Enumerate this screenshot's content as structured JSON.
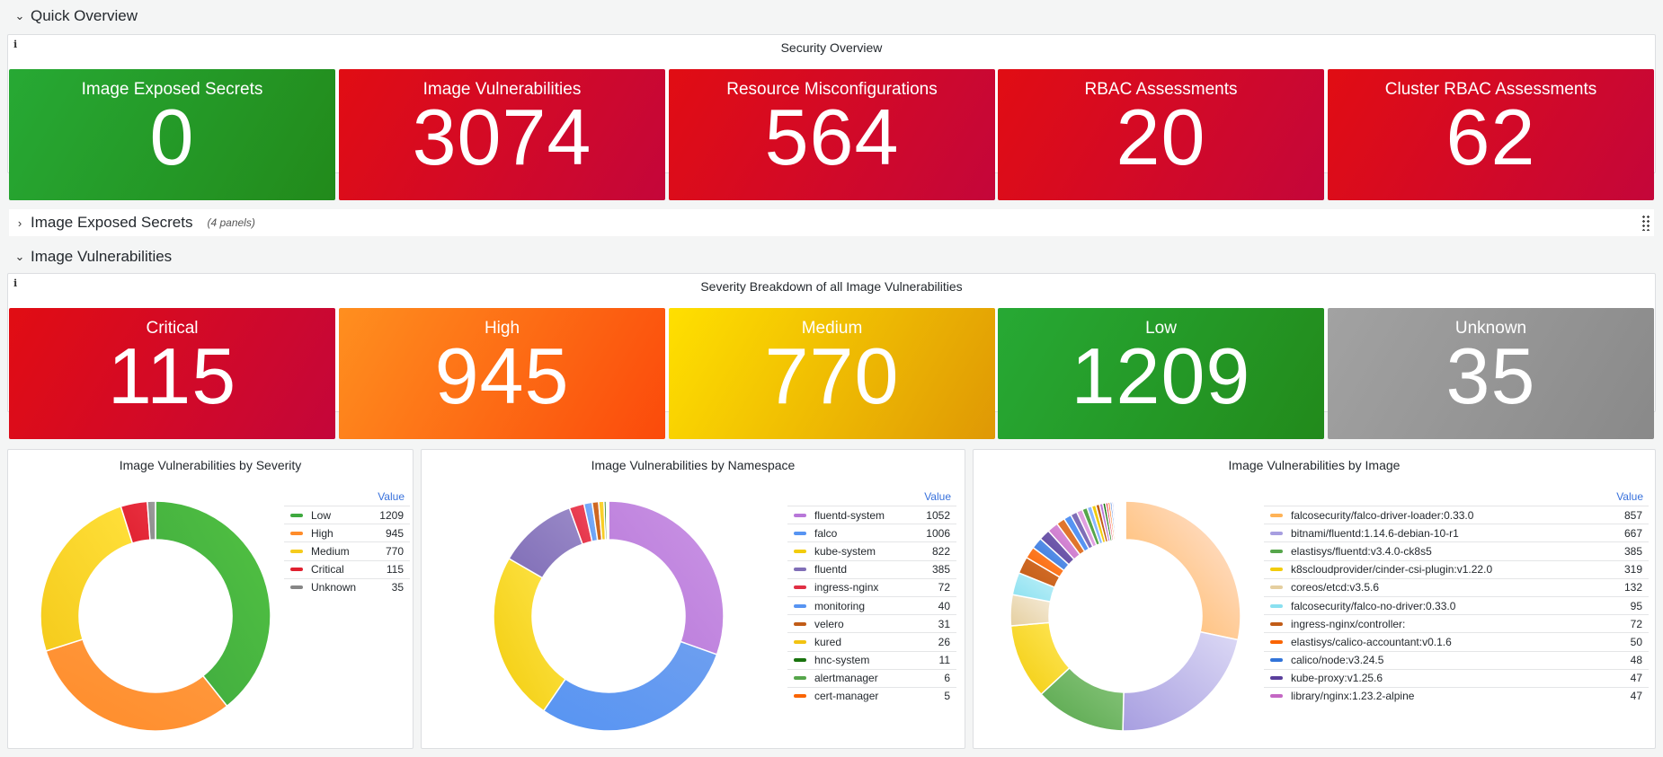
{
  "rows": {
    "quick_overview": {
      "chevron": "⌄",
      "title": "Quick Overview"
    },
    "exposed_secrets": {
      "chevron": "›",
      "title": "Image Exposed Secrets",
      "count": "(4 panels)"
    },
    "image_vulns": {
      "chevron": "⌄",
      "title": "Image Vulnerabilities"
    }
  },
  "security_overview": {
    "title": "Security Overview",
    "info_icon": "i",
    "stats": [
      {
        "label": "Image Exposed Secrets",
        "value": "0",
        "color_from": "#27a934",
        "color_to": "#228a1b"
      },
      {
        "label": "Image Vulnerabilities",
        "value": "3074",
        "color_from": "#e10d13",
        "color_to": "#c4063a"
      },
      {
        "label": "Resource Misconfigurations",
        "value": "564",
        "color_from": "#e10d13",
        "color_to": "#c4063a"
      },
      {
        "label": "RBAC Assessments",
        "value": "20",
        "color_from": "#e10d13",
        "color_to": "#c4063a"
      },
      {
        "label": "Cluster RBAC Assessments",
        "value": "62",
        "color_from": "#e10d13",
        "color_to": "#c4063a"
      }
    ]
  },
  "severity_breakdown": {
    "title": "Severity Breakdown of all Image Vulnerabilities",
    "info_icon": "i",
    "stats": [
      {
        "label": "Critical",
        "value": "115",
        "color_from": "#e10d13",
        "color_to": "#c4063a"
      },
      {
        "label": "High",
        "value": "945",
        "color_from": "#ff8f1f",
        "color_to": "#fb4a0b"
      },
      {
        "label": "Medium",
        "value": "770",
        "color_from": "#ffe000",
        "color_to": "#df9805"
      },
      {
        "label": "Low",
        "value": "1209",
        "color_from": "#27a934",
        "color_to": "#228a1b"
      },
      {
        "label": "Unknown",
        "value": "35",
        "color_from": "#a2a2a2",
        "color_to": "#898989"
      }
    ]
  },
  "legend_header": "Value",
  "chart_data": [
    {
      "type": "pie",
      "title": "Image Vulnerabilities by Severity",
      "categories": [
        "Low",
        "High",
        "Medium",
        "Critical",
        "Unknown"
      ],
      "values": [
        1209,
        945,
        770,
        115,
        35
      ],
      "colors": [
        "#3ea93f",
        "#ff8c2a",
        "#f5cb1c",
        "#e0202f",
        "#868686"
      ],
      "gradient_to": [
        "#52c242",
        "#ff9a40",
        "#ffe03a",
        "#e83040",
        "#a0a0a0"
      ],
      "legend": "right"
    },
    {
      "type": "pie",
      "title": "Image Vulnerabilities by Namespace",
      "categories": [
        "fluentd-system",
        "falco",
        "kube-system",
        "fluentd",
        "ingress-nginx",
        "monitoring",
        "velero",
        "kured",
        "hnc-system",
        "alertmanager",
        "cert-manager"
      ],
      "values": [
        1052,
        1006,
        822,
        385,
        72,
        40,
        31,
        26,
        11,
        6,
        5
      ],
      "colors": [
        "#b877d9",
        "#5794f2",
        "#f2cc0c",
        "#806eb7",
        "#e02f44",
        "#5794f2",
        "#c15c17",
        "#f2c311",
        "#19730e",
        "#56a64b",
        "#fa6400"
      ],
      "gradient_to": [
        "#ca95e5",
        "#6e9ff0",
        "#ffe64d",
        "#9a8ac8",
        "#f04a5e",
        "#8ab8ff",
        "#d8702b",
        "#ffd93d",
        "#37872d",
        "#73bf69",
        "#ff7a1f"
      ],
      "legend": "right"
    },
    {
      "type": "pie",
      "title": "Image Vulnerabilities by Image",
      "categories": [
        "falcosecurity/falco-driver-loader:0.33.0",
        "bitnami/fluentd:1.14.6-debian-10-r1",
        "elastisys/fluentd:v3.4.0-ck8s5",
        "k8scloudprovider/cinder-csi-plugin:v1.22.0",
        "coreos/etcd:v3.5.6",
        "falcosecurity/falco-no-driver:0.33.0",
        "ingress-nginx/controller:",
        "elastisys/calico-accountant:v0.1.6",
        "calico/node:v3.24.5",
        "kube-proxy:v1.25.6",
        "library/nginx:1.23.2-alpine"
      ],
      "values": [
        857,
        667,
        385,
        319,
        132,
        95,
        72,
        50,
        48,
        47,
        47
      ],
      "colors": [
        "#ffb357",
        "#a79ee0",
        "#56a64b",
        "#f2cc0c",
        "#e5cfa0",
        "#8ae0f0",
        "#c15c17",
        "#fa6400",
        "#3274d9",
        "#5a3f9c",
        "#c467c4"
      ],
      "gradient_to": [
        "#ffe5d9",
        "#dcd9f5",
        "#8ac67d",
        "#ffe75a",
        "#f5ebd8",
        "#c0f0f8",
        "#d8702b",
        "#ff8a40",
        "#6e9ff0",
        "#806eb7",
        "#e0a0e0"
      ],
      "extra_slices_color_cycle": [
        "#e0752d",
        "#5794f2",
        "#806eb7",
        "#e0a0e0",
        "#56a64b",
        "#8ab8ff",
        "#f2cc0c",
        "#c15c17",
        "#b877d9",
        "#19730e",
        "#e02f44",
        "#fa6400",
        "#3274d9",
        "#a79ee0",
        "#8ae0f0",
        "#ffb357",
        "#ca95e5"
      ],
      "legend": "right"
    }
  ]
}
